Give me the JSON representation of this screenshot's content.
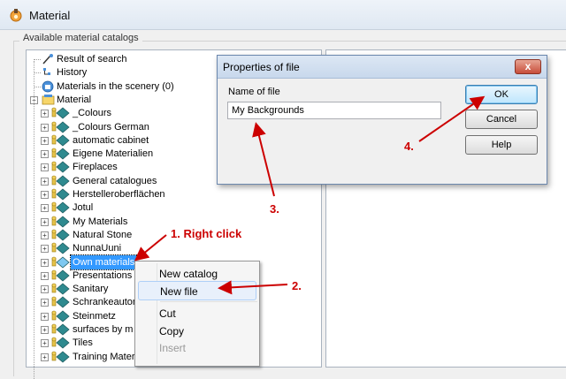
{
  "window": {
    "title": "Material"
  },
  "group": {
    "label": "Available material catalogs"
  },
  "tree": {
    "items": [
      {
        "label": "Result of search",
        "icon": "search-result-icon",
        "expandable": false
      },
      {
        "label": "History",
        "icon": "history-icon",
        "expandable": false
      },
      {
        "label": "Materials in the scenery (0)",
        "icon": "scenery-icon",
        "expandable": false
      },
      {
        "label": "Material",
        "icon": "folder-open-icon",
        "expandable": true,
        "expanded": true
      },
      {
        "label": "_Colours",
        "icon": "catalog-icon",
        "expandable": true
      },
      {
        "label": "_Colours German",
        "icon": "catalog-icon",
        "expandable": true
      },
      {
        "label": "automatic cabinet",
        "icon": "catalog-icon",
        "expandable": true
      },
      {
        "label": "Eigene Materialien",
        "icon": "catalog-icon",
        "expandable": true
      },
      {
        "label": "Fireplaces",
        "icon": "catalog-icon",
        "expandable": true
      },
      {
        "label": "General catalogues",
        "icon": "catalog-icon",
        "expandable": true
      },
      {
        "label": "Herstelleroberflächen",
        "icon": "catalog-icon",
        "expandable": true
      },
      {
        "label": "Jotul",
        "icon": "catalog-icon",
        "expandable": true
      },
      {
        "label": "My Materials",
        "icon": "catalog-icon",
        "expandable": true
      },
      {
        "label": "Natural Stone",
        "icon": "catalog-icon",
        "expandable": true
      },
      {
        "label": "NunnaUuni",
        "icon": "catalog-icon",
        "expandable": true
      },
      {
        "label": "Own materials",
        "icon": "catalog-icon",
        "expandable": true,
        "selected": true
      },
      {
        "label": "Presentations",
        "icon": "catalog-icon",
        "expandable": true
      },
      {
        "label": "Sanitary",
        "icon": "catalog-icon",
        "expandable": true
      },
      {
        "label": "Schrankeautom",
        "icon": "catalog-icon",
        "expandable": true
      },
      {
        "label": "Steinmetz",
        "icon": "catalog-icon",
        "expandable": true
      },
      {
        "label": "surfaces by m",
        "icon": "catalog-icon",
        "expandable": true
      },
      {
        "label": "Tiles",
        "icon": "catalog-icon",
        "expandable": true
      },
      {
        "label": "Training Mater",
        "icon": "catalog-icon",
        "expandable": true
      }
    ]
  },
  "context_menu": {
    "items": [
      {
        "label": "New catalog",
        "highlighted": false,
        "disabled": false
      },
      {
        "label": "New file",
        "highlighted": true,
        "disabled": false
      },
      {
        "label": "Cut",
        "highlighted": false,
        "disabled": false
      },
      {
        "label": "Copy",
        "highlighted": false,
        "disabled": false
      },
      {
        "label": "Insert",
        "highlighted": false,
        "disabled": true
      }
    ]
  },
  "dialog": {
    "title": "Properties of file",
    "close_label": "x",
    "name_label": "Name of file",
    "name_value": "My Backgrounds",
    "ok_label": "OK",
    "cancel_label": "Cancel",
    "help_label": "Help"
  },
  "annotations": {
    "step1": "1. Right click",
    "step2": "2.",
    "step3": "3.",
    "step4": "4.",
    "color": "#cc0000"
  },
  "colors": {
    "selection": "#3399ff",
    "catalog_icon": "#2f8a8f",
    "annotation": "#cc0000"
  }
}
